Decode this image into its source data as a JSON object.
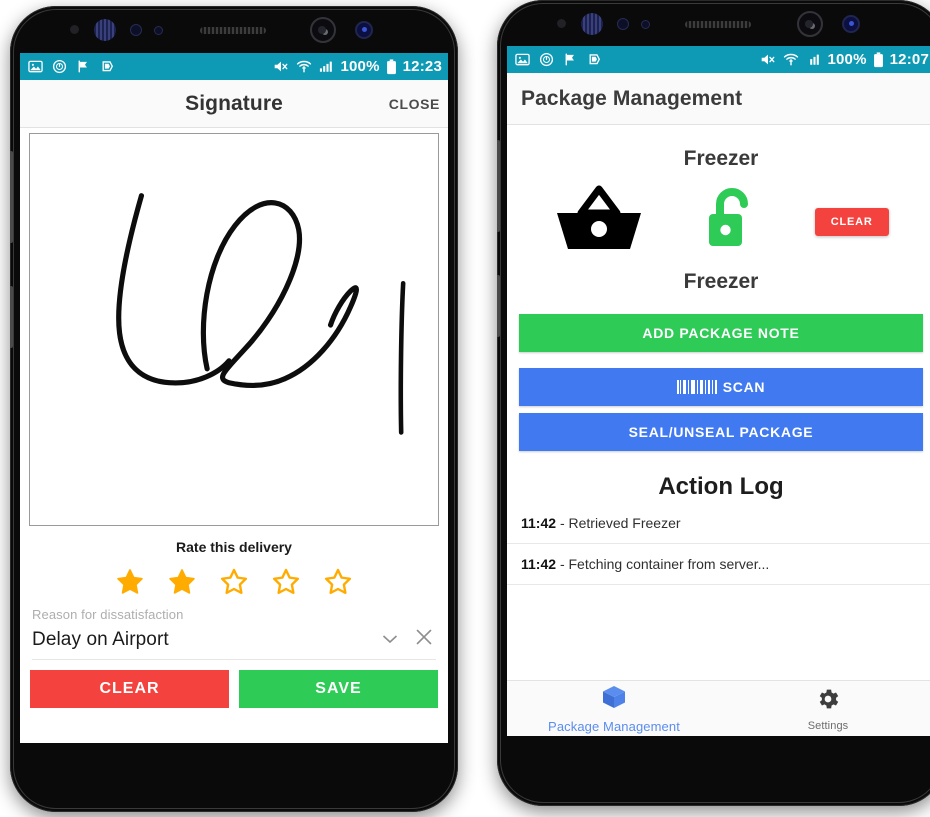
{
  "phone_left": {
    "status_bar": {
      "icons": [
        "image-icon",
        "clock-icon",
        "flag-icon",
        "send-icon"
      ],
      "right_icons": [
        "mute-icon",
        "wifi-icon",
        "signal-icon"
      ],
      "battery_percent": "100%",
      "time": "12:23"
    },
    "app_bar": {
      "title": "Signature",
      "action_label": "CLOSE"
    },
    "signature": {
      "rate_label": "Rate this delivery",
      "rating": 2,
      "max_rating": 5,
      "reason_label": "Reason for dissatisfaction",
      "reason_value": "Delay on Airport"
    },
    "actions": {
      "clear_label": "CLEAR",
      "save_label": "SAVE"
    }
  },
  "phone_right": {
    "status_bar": {
      "icons": [
        "image-icon",
        "clock-icon",
        "flag-icon",
        "send-icon"
      ],
      "right_icons": [
        "mute-icon",
        "wifi-icon",
        "signal-icon"
      ],
      "battery_percent": "100%",
      "time": "12:07"
    },
    "app_bar": {
      "title": "Package Management"
    },
    "container": {
      "top_label": "Freezer",
      "bottom_label": "Freezer",
      "basket_icon": "basket-icon",
      "lock_icon": "unlocked-padlock-icon",
      "lock_state": "unlocked",
      "clear_label": "CLEAR"
    },
    "buttons": [
      {
        "label": "ADD PACKAGE NOTE",
        "style": "green",
        "icon": null
      },
      {
        "label": "SCAN",
        "style": "blue",
        "icon": "barcode-icon"
      },
      {
        "label": "SEAL/UNSEAL PACKAGE",
        "style": "blue",
        "icon": null
      }
    ],
    "action_log": {
      "title": "Action Log",
      "entries": [
        {
          "time": "11:42",
          "separator": "-",
          "text": "Retrieved Freezer"
        },
        {
          "time": "11:42",
          "separator": "-",
          "text": "Fetching container from server..."
        }
      ]
    },
    "bottom_nav": [
      {
        "label": "Package Management",
        "icon": "package-box-icon",
        "active": true
      },
      {
        "label": "Settings",
        "icon": "gear-icon",
        "active": false
      }
    ]
  },
  "colors": {
    "status_bar_teal": "#0E9AB5",
    "danger_red": "#F4433F",
    "success_green": "#2ECC56",
    "primary_blue": "#4179F1",
    "star_amber": "#FFAB00",
    "nav_active_blue": "#5B8DEF",
    "lock_green": "#2ECC56"
  }
}
